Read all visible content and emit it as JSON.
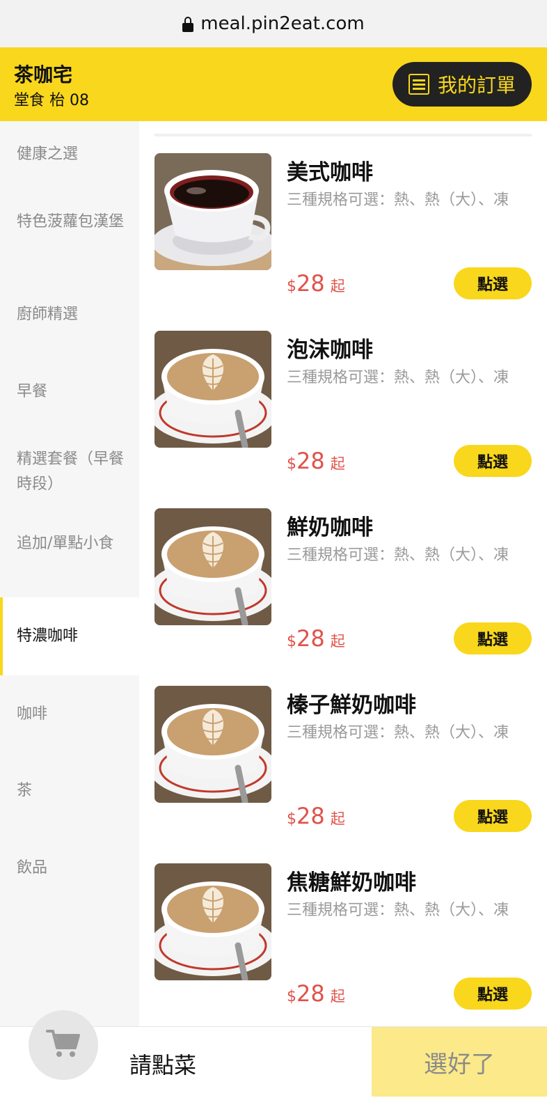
{
  "browser": {
    "url": "meal.pin2eat.com"
  },
  "header": {
    "store_name": "茶咖宅",
    "table_info": "堂食 枱 08",
    "orders_label": "我的訂單"
  },
  "sidebar": {
    "items": [
      {
        "label": "健康之選",
        "active": false
      },
      {
        "label": "特色菠蘿包漢堡",
        "active": false
      },
      {
        "label": "廚師精選",
        "active": false
      },
      {
        "label": "早餐",
        "active": false
      },
      {
        "label": "精選套餐（早餐時段）",
        "active": false
      },
      {
        "label": "追加/單點小食",
        "active": false
      },
      {
        "label": "特濃咖啡",
        "active": true
      },
      {
        "label": "咖啡",
        "active": false
      },
      {
        "label": "茶",
        "active": false
      },
      {
        "label": "飲品",
        "active": false
      }
    ]
  },
  "products": [
    {
      "name": "美式咖啡",
      "description": "三種規格可選：熱、熱（大）、凍",
      "currency": "$",
      "price": "28",
      "price_suffix": "起",
      "button_label": "點選",
      "image_icon": "black-coffee-cup"
    },
    {
      "name": "泡沫咖啡",
      "description": "三種規格可選：熱、熱（大）、凍",
      "currency": "$",
      "price": "28",
      "price_suffix": "起",
      "button_label": "點選",
      "image_icon": "latte-art-cup"
    },
    {
      "name": "鮮奶咖啡",
      "description": "三種規格可選：熱、熱（大）、凍",
      "currency": "$",
      "price": "28",
      "price_suffix": "起",
      "button_label": "點選",
      "image_icon": "latte-art-cup"
    },
    {
      "name": "榛子鮮奶咖啡",
      "description": "三種規格可選：熱、熱（大）、凍",
      "currency": "$",
      "price": "28",
      "price_suffix": "起",
      "button_label": "點選",
      "image_icon": "latte-art-cup"
    },
    {
      "name": "焦糖鮮奶咖啡",
      "description": "三種規格可選：熱、熱（大）、凍",
      "currency": "$",
      "price": "28",
      "price_suffix": "起",
      "button_label": "點選",
      "image_icon": "latte-art-cup"
    }
  ],
  "bottom_bar": {
    "cart_icon": "shopping-cart-icon",
    "prompt": "請點菜",
    "done_label": "選好了"
  },
  "colors": {
    "brand_yellow": "#f9d71c",
    "price_red": "#e0524a",
    "dark_button": "#222222",
    "done_button": "#fbe98a"
  }
}
